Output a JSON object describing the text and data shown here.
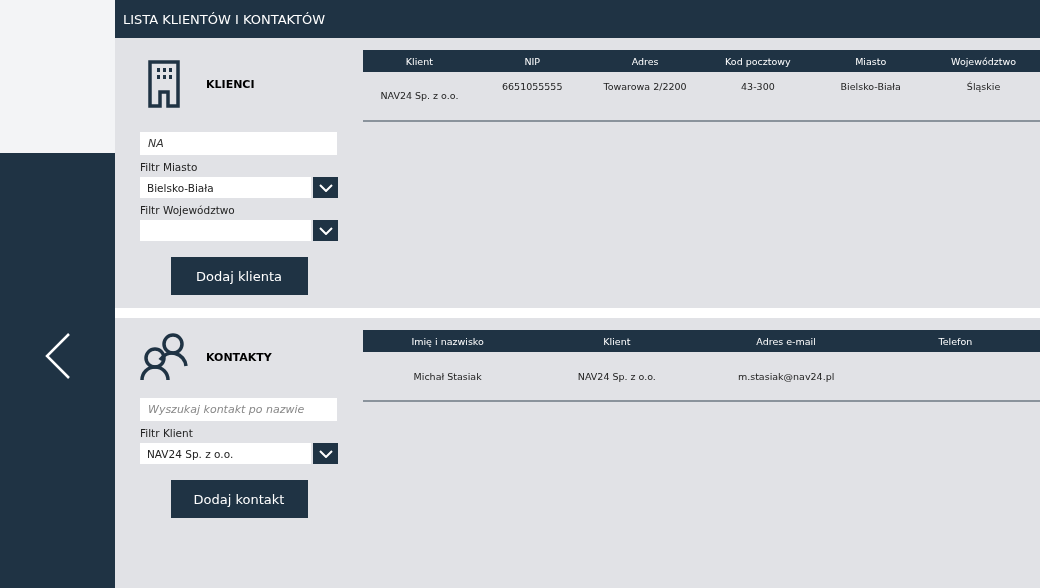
{
  "header": {
    "title": "LISTA KLIENTÓW I KONTAKTÓW"
  },
  "sections": [
    {
      "kind": "clients",
      "title": "KLIENCI",
      "search": {
        "value": "NA"
      },
      "filters": [
        {
          "label": "Filtr Miasto",
          "value": "Bielsko-Biała"
        },
        {
          "label": "Filtr Województwo"
        }
      ],
      "button": "Dodaj klienta",
      "table": {
        "columns": [
          "Klient",
          "NIP",
          "Adres",
          "Kod pocztowy",
          "Miasto",
          "Województwo"
        ],
        "rows": [
          [
            "NAV24 Sp. z o.o.",
            "6651055555",
            "Towarowa 2/2200",
            "43-300",
            "Bielsko-Biała",
            "Śląskie"
          ]
        ]
      }
    },
    {
      "kind": "contacts",
      "title": "KONTAKTY",
      "search": {
        "placeholder": "Wyszukaj kontakt po nazwie"
      },
      "filters": [
        {
          "label": "Filtr Klient",
          "value": "NAV24 Sp. z o.o."
        }
      ],
      "button": "Dodaj kontakt",
      "table": {
        "columns": [
          "Imię i nazwisko",
          "Klient",
          "Adres e-mail",
          "Telefon"
        ],
        "rows": [
          [
            "Michał Stasiak",
            "NAV24 Sp. z o.o.",
            "m.stasiak@nav24.pl",
            ""
          ]
        ]
      }
    }
  ]
}
